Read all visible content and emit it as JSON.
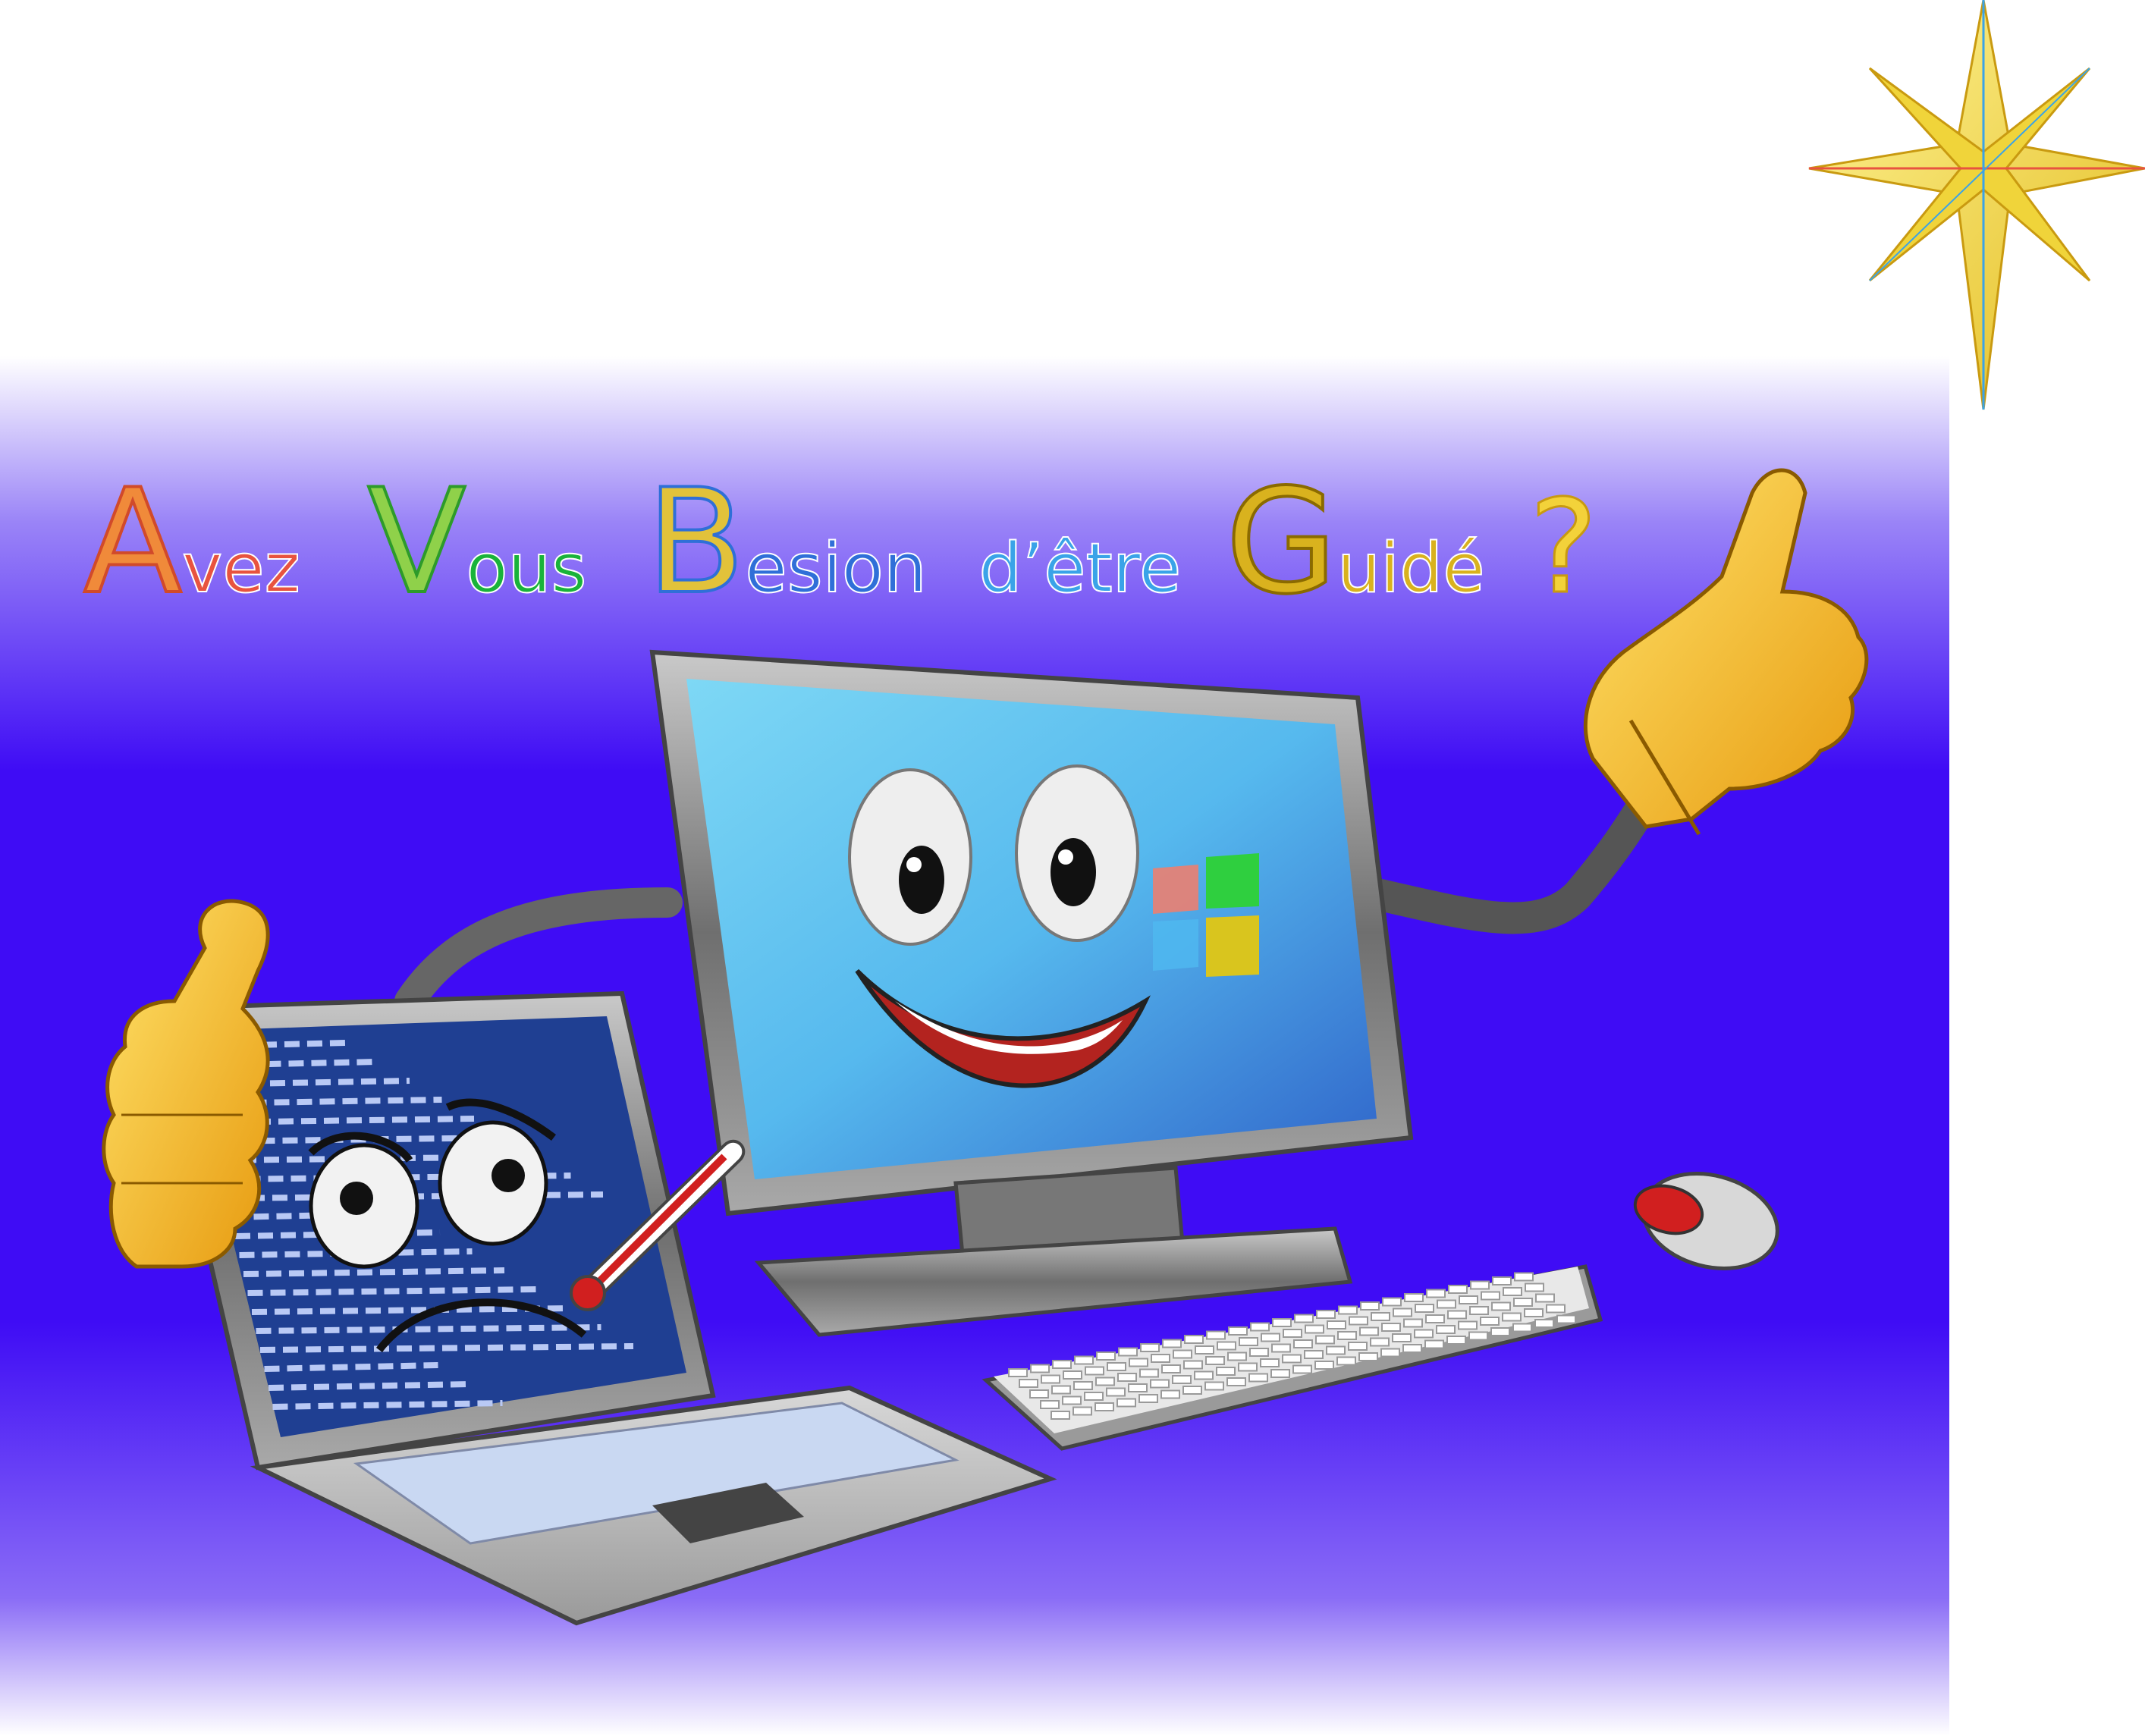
{
  "headline": {
    "words": [
      {
        "initial": "A",
        "rest": "vez",
        "initial_color": "#f08a3a",
        "rest_color": "#e8533f"
      },
      {
        "initial": "V",
        "rest": "ous",
        "initial_color": "#8fd14a",
        "rest_color": "#19b33a"
      },
      {
        "initial": "B",
        "rest": "esion",
        "initial_color": "#e2c23a",
        "rest_color": "#2f6fd8"
      },
      {
        "initial": "",
        "rest": "d’être",
        "initial_color": "#2f6fd8",
        "rest_color": "#3aa3e8"
      },
      {
        "initial": "G",
        "rest": "uidé",
        "initial_color": "#d9b21e",
        "rest_color": "#d9b21e"
      }
    ],
    "question_mark": "?",
    "question_color": "#f3d23a"
  },
  "colors": {
    "banner_top": "#ffffff",
    "banner_mid": "#3f0cf5",
    "star_gold": "#f4e34a",
    "monitor_screen": "#5fc7ef",
    "laptop_screen": "#1f3f92",
    "glove": "#f7c42a"
  },
  "icons": [
    "star-icon",
    "windows-logo-icon",
    "thermometer-icon",
    "mouse-icon",
    "keyboard-icon"
  ]
}
